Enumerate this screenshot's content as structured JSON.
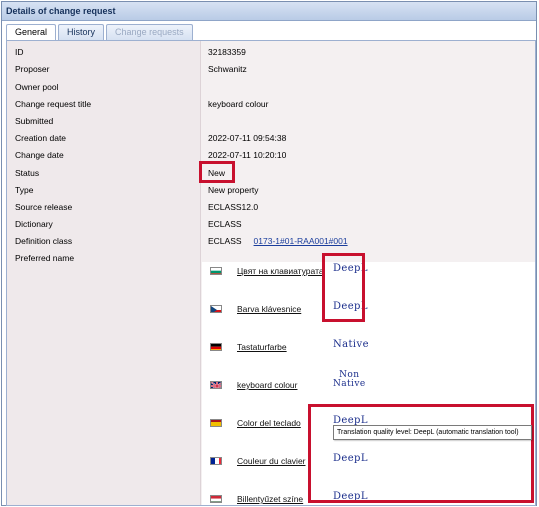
{
  "panel": {
    "title": "Details of change request"
  },
  "tabs": [
    {
      "label": "General",
      "state": "active"
    },
    {
      "label": "History",
      "state": "normal"
    },
    {
      "label": "Change requests",
      "state": "disabled"
    }
  ],
  "fields": [
    {
      "label": "ID",
      "value": "32183359"
    },
    {
      "label": "Proposer",
      "value": "Schwanitz"
    },
    {
      "label": "Owner pool",
      "value": ""
    },
    {
      "label": "Change request title",
      "value": "keyboard colour"
    },
    {
      "label": "Submitted",
      "value": ""
    },
    {
      "label": "Creation date",
      "value": "2022-07-11 09:54:38"
    },
    {
      "label": "Change date",
      "value": "2022-07-11 10:20:10"
    },
    {
      "label": "Status",
      "value": "New"
    },
    {
      "label": "Type",
      "value": "New property"
    },
    {
      "label": "Source release",
      "value": "ECLASS12.0"
    },
    {
      "label": "Dictionary",
      "value": "ECLASS"
    },
    {
      "label": "Definition class",
      "value": "ECLASS",
      "link": "0173-1#01-RAA001#001"
    },
    {
      "label": "Preferred name",
      "value": ""
    }
  ],
  "preferred_names": [
    {
      "flag": "bg",
      "text": "Цвят на клавиатурата",
      "source": "DeepL"
    },
    {
      "flag": "cz",
      "text": "Barva klávesnice",
      "source": "DeepL"
    },
    {
      "flag": "de",
      "text": "Tastaturfarbe",
      "source": "Native"
    },
    {
      "flag": "gb",
      "text": "keyboard colour",
      "source_line1": "Non",
      "source_line2": "Native"
    },
    {
      "flag": "es",
      "text": "Color del teclado",
      "source": "DeepL"
    },
    {
      "flag": "fr",
      "text": "Couleur du clavier",
      "source": "DeepL"
    },
    {
      "flag": "hu",
      "text": "Billentyűzet színe",
      "source": "DeepL"
    }
  ],
  "tooltip": {
    "text": "Translation quality level: DeepL (automatic translation tool)"
  },
  "colors": {
    "highlight": "#c8102e",
    "link": "#1a3d9c",
    "source_text": "#1c2f8c"
  }
}
